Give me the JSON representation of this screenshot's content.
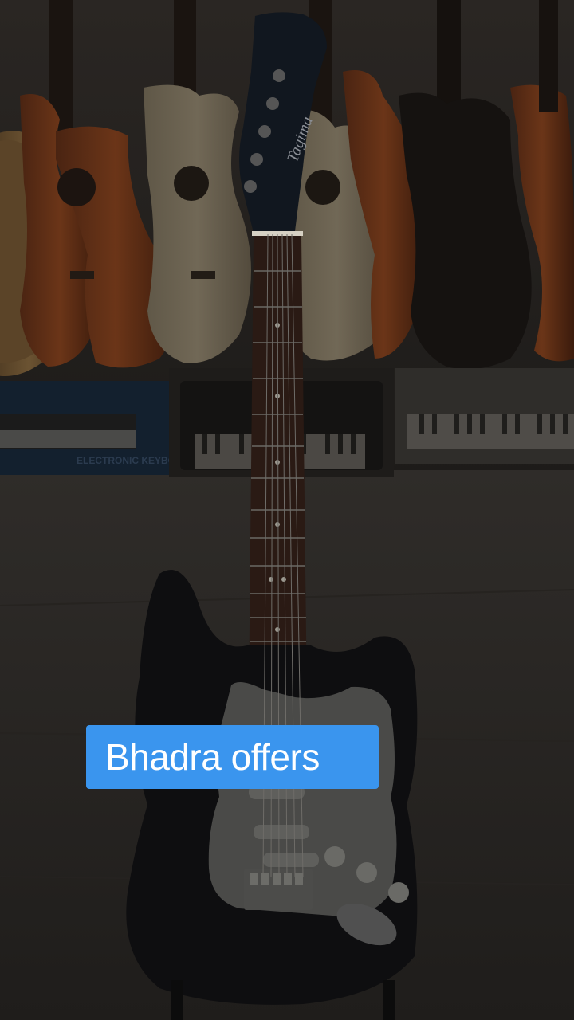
{
  "video": {
    "caption": "Bhadra offers",
    "headstock_brand": "Tagima"
  },
  "keyboards": {
    "left_box_text": "ELECTRONIC KEYBOARD"
  },
  "colors": {
    "caption_background": "#3a95ee",
    "caption_text": "#ffffff"
  }
}
